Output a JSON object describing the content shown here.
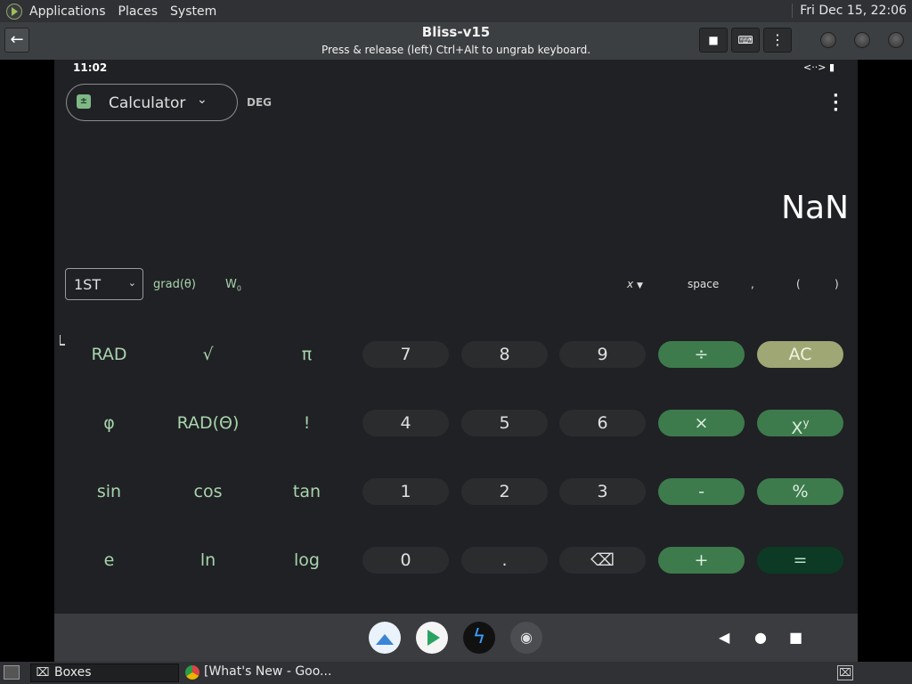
{
  "top_panel": {
    "menus": [
      "Applications",
      "Places",
      "System"
    ],
    "clock": "Fri Dec 15, 22:06"
  },
  "window": {
    "title": "Bliss-v15",
    "subtitle": "Press & release (left) Ctrl+Alt to ungrab keyboard."
  },
  "status_bar": {
    "time": "11:02"
  },
  "app": {
    "name": "Calculator",
    "angle_mode": "DEG",
    "display_value": "NaN",
    "row_select": "1ST",
    "function_row": [
      "grad(θ)",
      "W",
      "x",
      "space",
      ",",
      "(",
      ")"
    ],
    "w0_sub": "0"
  },
  "keypad": {
    "r1": [
      "RAD",
      "√",
      "π",
      "7",
      "8",
      "9",
      "÷",
      "AC"
    ],
    "r2": [
      "φ",
      "RAD(Θ)",
      "!",
      "4",
      "5",
      "6",
      "×",
      "X"
    ],
    "r2_sup": "y",
    "r3": [
      "sin",
      "cos",
      "tan",
      "1",
      "2",
      "3",
      "-",
      "%"
    ],
    "r4": [
      "e",
      "ln",
      "log",
      "0",
      ".",
      "⌫",
      "+",
      "="
    ]
  },
  "taskbar": {
    "tasks": [
      "Boxes",
      "[What's New - Goo..."
    ]
  },
  "colors": {
    "screen_bg": "#202124",
    "num_key": "#2b2c2e",
    "op_key": "#3d7b4d",
    "ac_key": "#9fa875",
    "eq_key": "#0c3a25",
    "fn_text": "#a8d4ad"
  }
}
